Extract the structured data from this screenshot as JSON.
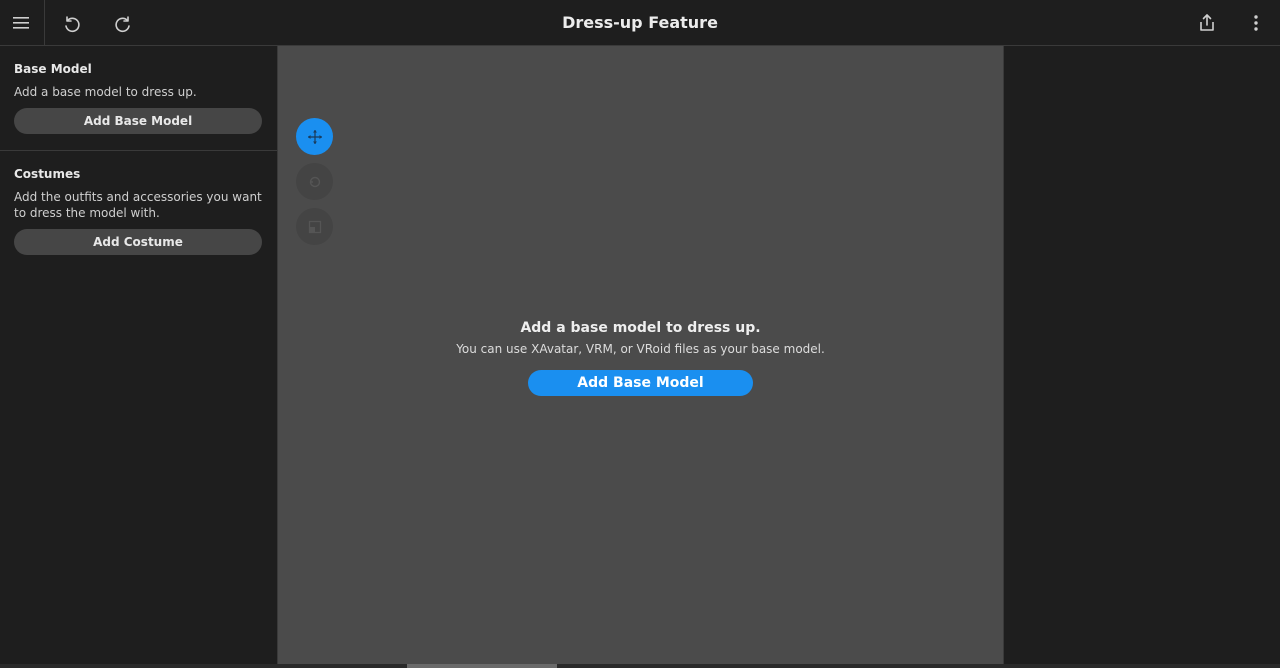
{
  "app": {
    "title": "Dress-up Feature"
  },
  "toolbar": {
    "menu_icon": "hamburger-menu-icon",
    "undo_icon": "undo-icon",
    "redo_icon": "redo-icon",
    "share_icon": "share-icon",
    "more_icon": "more-vertical-icon"
  },
  "sidebar": {
    "base_model": {
      "title": "Base Model",
      "description": "Add a base model to dress up.",
      "button_label": "Add Base Model"
    },
    "costumes": {
      "title": "Costumes",
      "description": "Add the outfits and accessories you want to dress the model with.",
      "button_label": "Add Costume"
    }
  },
  "viewport": {
    "tools": [
      {
        "name": "move-tool",
        "icon": "move-icon",
        "active": true
      },
      {
        "name": "rotate-tool",
        "icon": "rotate-icon",
        "active": false
      },
      {
        "name": "frame-tool",
        "icon": "frame-icon",
        "active": false
      }
    ],
    "empty_state": {
      "title": "Add a base model to dress up.",
      "subtitle": "You can use XAvatar, VRM, or VRoid files as your base model.",
      "button_label": "Add Base Model"
    }
  },
  "colors": {
    "accent": "#1a8ff0",
    "background": "#1e1e1e",
    "viewport": "#4b4b4b",
    "button": "#464646"
  }
}
